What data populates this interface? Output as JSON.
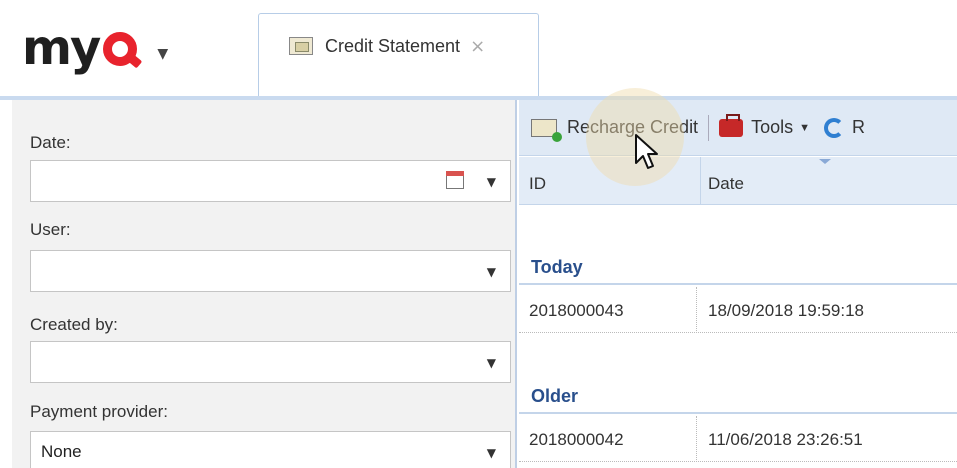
{
  "app": {
    "logo_text": "my",
    "logo_accent_color": "#e8232d"
  },
  "tab": {
    "label": "Credit Statement",
    "close_glyph": "×",
    "icon": "money-icon"
  },
  "filters": {
    "date_label": "Date:",
    "date_value": "",
    "user_label": "User:",
    "user_value": "",
    "created_by_label": "Created by:",
    "created_by_value": "",
    "payment_provider_label": "Payment provider:",
    "payment_provider_value": "None"
  },
  "toolbar": {
    "recharge_label": "Recharge Credit",
    "tools_label": "Tools",
    "refresh_label": "R"
  },
  "grid": {
    "columns": [
      "ID",
      "Date"
    ],
    "groups": [
      {
        "label": "Today",
        "rows": [
          {
            "id": "2018000043",
            "date": "18/09/2018 19:59:18"
          }
        ]
      },
      {
        "label": "Older",
        "rows": [
          {
            "id": "2018000042",
            "date": "11/06/2018 23:26:51"
          }
        ]
      }
    ]
  }
}
